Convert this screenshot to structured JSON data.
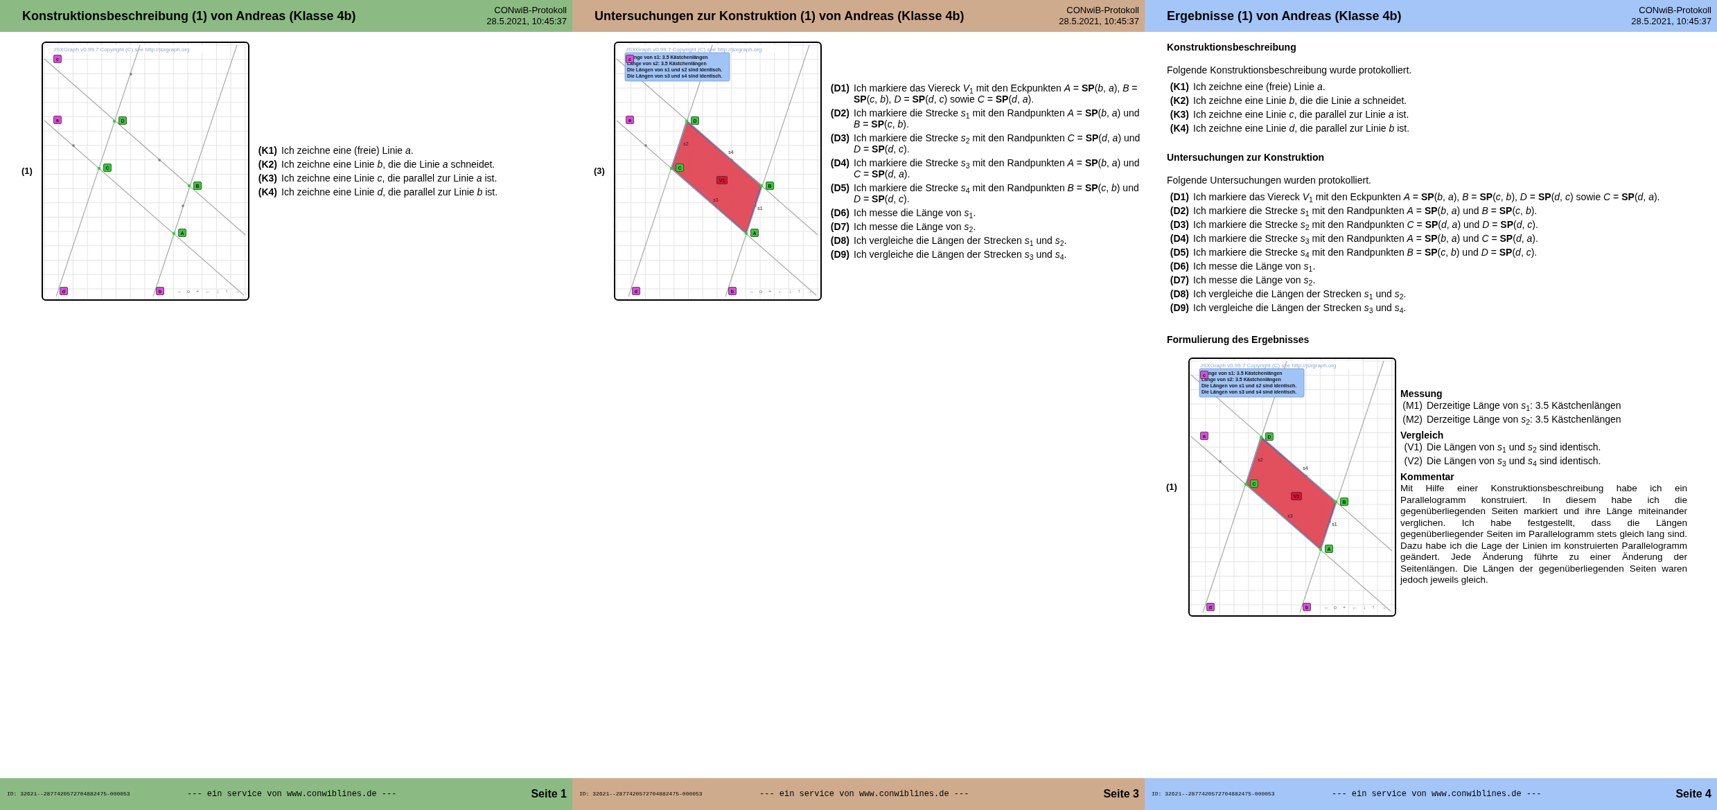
{
  "pages": [
    {
      "kind": "figure",
      "color": "#8bbb83",
      "title": "Konstruktionsbeschreibung (1) von Andreas (Klasse 4b)",
      "protocol": "CONwiB-Protokoll",
      "timestamp": "28.5.2021, 10:45:37",
      "figure": {
        "number": "(1)",
        "board": {
          "copyright": "JSXGraph v0.99.7 Copyright (C) see http://jsxgraph.org",
          "line_labels": [
            "c",
            "a",
            "d",
            "b"
          ],
          "point_labels": [
            "D",
            "C",
            "B",
            "A"
          ],
          "nav": [
            "–",
            "o",
            "+",
            "←",
            "↓",
            "↑",
            "→"
          ]
        }
      },
      "steps": [
        {
          "label": "(K1)",
          "text": "Ich zeichne eine (freie) Linie *a*."
        },
        {
          "label": "(K2)",
          "text": "Ich zeichne eine Linie *b*, die die Linie *a* schneidet."
        },
        {
          "label": "(K3)",
          "text": "Ich zeichne eine Linie *c*, die parallel zur Linie *a* ist."
        },
        {
          "label": "(K4)",
          "text": "Ich zeichne eine Linie *d*, die parallel zur Linie *b* ist."
        }
      ],
      "footer": {
        "id": "ID: 32621--2877420572704882475-000053",
        "service": "--- ein service von www.conwiblines.de ---",
        "page": "Seite 1"
      }
    },
    {
      "kind": "figure",
      "color": "#cfab8d",
      "title": "Untersuchungen zur Konstruktion (1) von Andreas (Klasse 4b)",
      "protocol": "CONwiB-Protokoll",
      "timestamp": "28.5.2021, 10:45:37",
      "figure": {
        "number": "(3)",
        "board": {
          "copyright": "JSXGraph v0.99.7 Copyright (C) see http://jsxgraph.org",
          "line_labels": [
            "c",
            "a",
            "d",
            "b"
          ],
          "point_labels": [
            "D",
            "C",
            "B",
            "A"
          ],
          "polygon": {
            "label": "V1",
            "side_labels": [
              "s2",
              "s4",
              "s3",
              "s1"
            ]
          },
          "info_lines": [
            "nge von s1: 3.5 Kästchenlängen",
            "Länge von s2: 3.5 Kästchenlängen",
            "Die Längen von s1 und s2 sind identisch.",
            "Die Längen von s3 und s4 sind identisch."
          ],
          "nav": [
            "–",
            "o",
            "+",
            "←",
            "↓",
            "↑",
            "→"
          ]
        }
      },
      "steps": [
        {
          "label": "(D1)",
          "text": "Ich markiere das Viereck *V*$_{1}$ mit den Eckpunkten *A* = **SP**(*b*, *a*), *B* = **SP**(*c*, *b*), *D* = **SP**(*d*, *c*) sowie *C* = **SP**(*d*, *a*)."
        },
        {
          "label": "(D2)",
          "text": "Ich markiere die Strecke *s*$_{1}$ mit den Randpunkten *A* = **SP**(*b*, *a*) und *B* = **SP**(*c*, *b*)."
        },
        {
          "label": "(D3)",
          "text": "Ich markiere die Strecke *s*$_{2}$ mit den Randpunkten *C* = **SP**(*d*, *a*) und *D* = **SP**(*d*, *c*)."
        },
        {
          "label": "(D4)",
          "text": "Ich markiere die Strecke *s*$_{3}$ mit den Randpunkten *A* = **SP**(*b*, *a*) und *C* = **SP**(*d*, *a*)."
        },
        {
          "label": "(D5)",
          "text": "Ich markiere die Strecke *s*$_{4}$ mit den Randpunkten *B* = **SP**(*c*, *b*) und *D* = **SP**(*d*, *c*)."
        },
        {
          "label": "(D6)",
          "text": "Ich messe die Länge von *s*$_{1}$."
        },
        {
          "label": "(D7)",
          "text": "Ich messe die Länge von *s*$_{2}$."
        },
        {
          "label": "(D8)",
          "text": "Ich vergleiche die Längen der Strecken *s*$_{1}$ und *s*$_{2}$."
        },
        {
          "label": "(D9)",
          "text": "Ich vergleiche die Längen der Strecken *s*$_{3}$ und *s*$_{4}$."
        }
      ],
      "footer": {
        "id": "ID: 32621--2877420572704882475-000053",
        "service": "--- ein service von www.conwiblines.de ---",
        "page": "Seite 3"
      }
    },
    {
      "kind": "results",
      "color": "#a3c5f7",
      "title": "Ergebnisse (1) von Andreas (Klasse 4b)",
      "protocol": "CONwiB-Protokoll",
      "timestamp": "28.5.2021, 10:45:37",
      "sections": [
        {
          "heading": "Konstruktionsbeschreibung",
          "intro": "Folgende Konstruktionsbeschreibung wurde protokolliert.",
          "steps": [
            {
              "label": "(K1)",
              "text": "Ich zeichne eine (freie) Linie *a*."
            },
            {
              "label": "(K2)",
              "text": "Ich zeichne eine Linie *b*, die die Linie *a* schneidet."
            },
            {
              "label": "(K3)",
              "text": "Ich zeichne eine Linie *c*, die parallel zur Linie *a* ist."
            },
            {
              "label": "(K4)",
              "text": "Ich zeichne eine Linie *d*, die parallel zur Linie *b* ist."
            }
          ]
        },
        {
          "heading": "Untersuchungen zur Konstruktion",
          "intro": "Folgende Untersuchungen wurden protokolliert.",
          "steps": [
            {
              "label": "(D1)",
              "text": "Ich markiere das Viereck *V*$_{1}$ mit den Eckpunkten *A* = **SP**(*b*, *a*), *B* = **SP**(*c*, *b*), *D* = **SP**(*d*, *c*) sowie *C* = **SP**(*d*, *a*)."
            },
            {
              "label": "(D2)",
              "text": "Ich markiere die Strecke *s*$_{1}$ mit den Randpunkten *A* = **SP**(*b*, *a*) und *B* = **SP**(*c*, *b*)."
            },
            {
              "label": "(D3)",
              "text": "Ich markiere die Strecke *s*$_{2}$ mit den Randpunkten *C* = **SP**(*d*, *a*) und *D* = **SP**(*d*, *c*)."
            },
            {
              "label": "(D4)",
              "text": "Ich markiere die Strecke *s*$_{3}$ mit den Randpunkten *A* = **SP**(*b*, *a*) und *C* = **SP**(*d*, *a*)."
            },
            {
              "label": "(D5)",
              "text": "Ich markiere die Strecke *s*$_{4}$ mit den Randpunkten *B* = **SP**(*c*, *b*) und *D* = **SP**(*d*, *c*)."
            },
            {
              "label": "(D6)",
              "text": "Ich messe die Länge von *s*$_{1}$."
            },
            {
              "label": "(D7)",
              "text": "Ich messe die Länge von *s*$_{2}$."
            },
            {
              "label": "(D8)",
              "text": "Ich vergleiche die Längen der Strecken *s*$_{1}$ und *s*$_{2}$."
            },
            {
              "label": "(D9)",
              "text": "Ich vergleiche die Längen der Strecken *s*$_{3}$ und *s*$_{4}$."
            }
          ]
        }
      ],
      "result": {
        "heading": "Formulierung des Ergebnisses",
        "figure": {
          "number": "(1)",
          "board": {
            "copyright": "JSXGraph v0.99.7 Copyright (C) see http://jsxgraph.org",
            "line_labels": [
              "c",
              "a",
              "d",
              "b"
            ],
            "point_labels": [
              "D",
              "C",
              "B",
              "A"
            ],
            "polygon": {
              "label": "V1",
              "side_labels": [
                "s2",
                "s4",
                "s3",
                "s1"
              ]
            },
            "info_lines": [
              "nge von s1: 3.5 Kästchenlängen",
              "Länge von s2: 3.5 Kästchenlängen",
              "Die Längen von s1 und s2 sind identisch.",
              "Die Längen von s3 und s4 sind identisch."
            ],
            "nav": [
              "–",
              "o",
              "+",
              "←",
              "↓",
              "↑",
              "→"
            ]
          }
        },
        "groups": [
          {
            "heading": "Messung",
            "items": [
              {
                "label": "(M1)",
                "text": "Derzeitige Länge von *s*$_{1}$: 3.5 Kästchenlängen"
              },
              {
                "label": "(M2)",
                "text": "Derzeitige Länge von *s*$_{2}$: 3.5 Kästchenlängen"
              }
            ]
          },
          {
            "heading": "Vergleich",
            "items": [
              {
                "label": "(V1)",
                "text": "Die Längen von *s*$_{1}$ und *s*$_{2}$ sind identisch."
              },
              {
                "label": "(V2)",
                "text": "Die Längen von *s*$_{3}$ und *s*$_{4}$ sind identisch."
              }
            ]
          }
        ],
        "comment": {
          "heading": "Kommentar",
          "text": "Mit Hilfe einer Konstruktionsbeschreibung habe ich ein Parallelogramm konstruiert. In diesem habe ich die gegenüberliegenden Seiten markiert und ihre Länge miteinander verglichen. Ich habe festgestellt, dass die Längen gegenüberliegender Seiten im Parallelogramm stets gleich lang sind. Dazu habe ich die Lage der Linien im konstruierten Parallelogramm geändert. Jede Änderung führte zu einer Änderung der Seitenlängen. Die Längen der gegenüberliegenden Seiten waren jedoch jeweils gleich."
        }
      },
      "footer": {
        "id": "ID: 32621--2877420572704882475-000053",
        "service": "--- ein service von www.conwiblines.de ---",
        "page": "Seite 4"
      }
    }
  ]
}
